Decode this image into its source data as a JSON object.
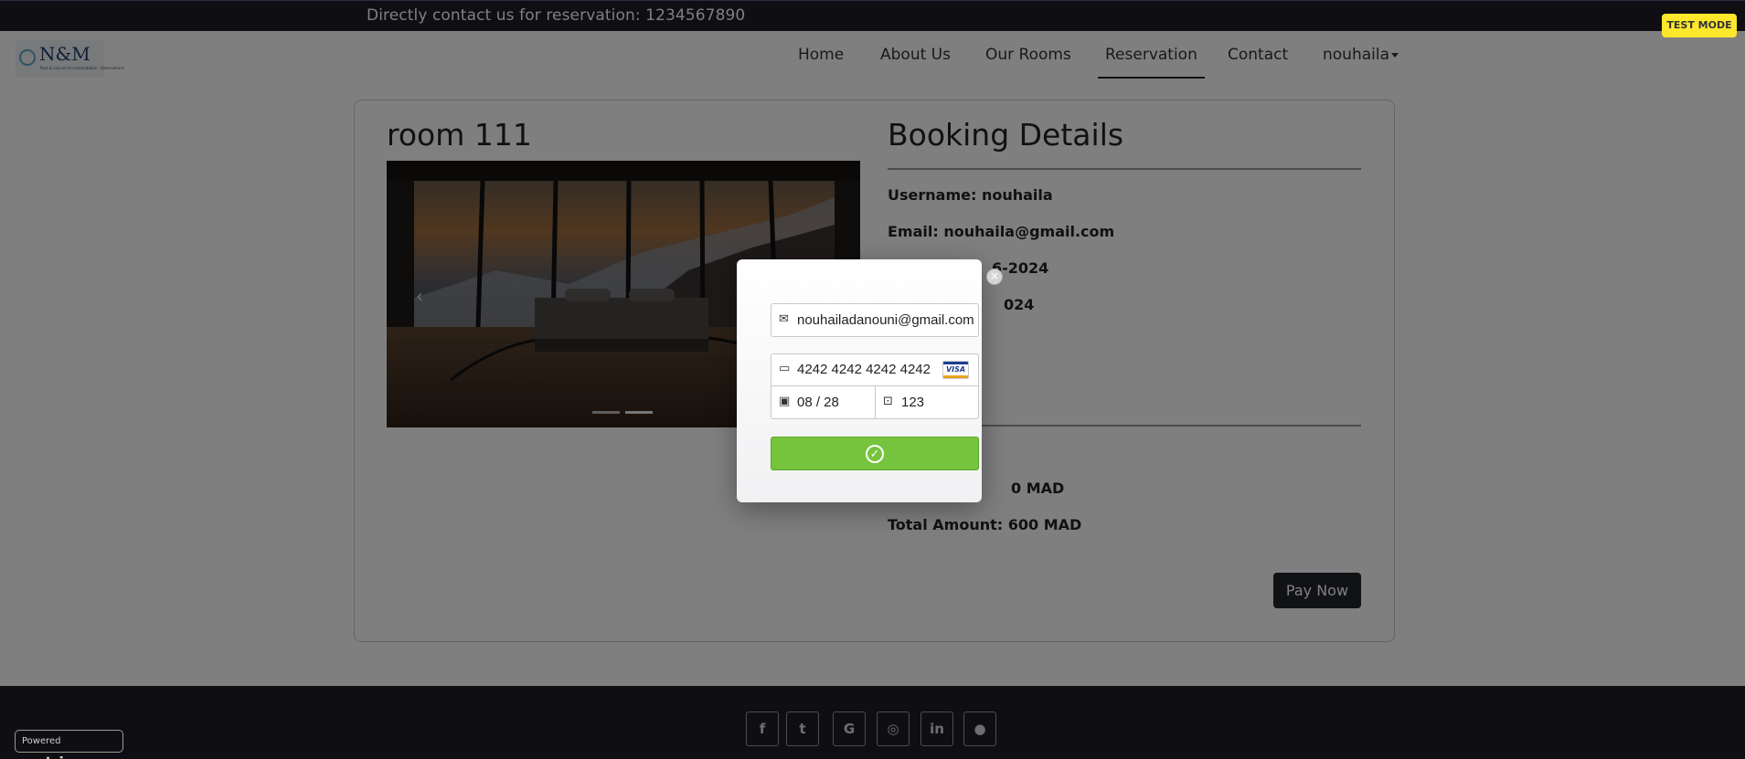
{
  "topbar": {
    "contact_text": "Directly contact us for reservation: 1234567890"
  },
  "logo": {
    "text": "N&M",
    "tagline": "Rest & Leisure Accommodation · Reservations"
  },
  "nav": {
    "items": [
      {
        "label": "Home"
      },
      {
        "label": "About Us"
      },
      {
        "label": "Our Rooms"
      },
      {
        "label": "Reservation",
        "active": true
      },
      {
        "label": "Contact"
      }
    ],
    "user_label": "nouhaila"
  },
  "room": {
    "title": "room 111",
    "carousel_prev": "‹",
    "slides": 2,
    "active_slide": 2
  },
  "booking": {
    "title": "Booking Details",
    "username": "Username: nouhaila",
    "email": "Email: nouhaila@gmail.com",
    "checkin_partial": "6-2024",
    "checkout_partial": "024",
    "price_partial": "0 MAD",
    "total": "Total Amount: 600 MAD",
    "pay_label": "Pay Now"
  },
  "footer": {
    "social_icons": [
      "facebook-icon",
      "twitter-icon",
      "google-icon",
      "instagram-icon",
      "linkedin-icon",
      "github-icon"
    ]
  },
  "stripe": {
    "test_mode": "TEST MODE",
    "badge_powered": "Powered by",
    "badge_brand": "stripe",
    "email_value": "nouhailadanouni@gmail.com",
    "card_number": "4242 4242 4242 4242",
    "expiry": "08 / 28",
    "cvc": "123",
    "card_brand": "VISA",
    "submit_color": "#76c43d"
  }
}
